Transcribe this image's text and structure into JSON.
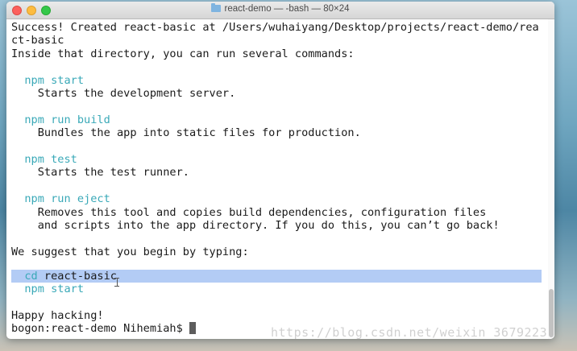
{
  "window": {
    "title": "react-demo — -bash — 80×24"
  },
  "terminal": {
    "lines": [
      "Success! Created react-basic at /Users/wuhaiyang/Desktop/projects/react-demo/rea",
      "ct-basic",
      "Inside that directory, you can run several commands:",
      "",
      "  npm start",
      "    Starts the development server.",
      "",
      "  npm run build",
      "    Bundles the app into static files for production.",
      "",
      "  npm test",
      "    Starts the test runner.",
      "",
      "  npm run eject",
      "    Removes this tool and copies build dependencies, configuration files",
      "    and scripts into the app directory. If you do this, you can’t go back!",
      "",
      "We suggest that you begin by typing:",
      "",
      "  cd react-basic",
      "  npm start",
      "",
      "Happy hacking!",
      "bogon:react-demo Nihemiah$ "
    ],
    "commands": {
      "npm_start": "npm start",
      "npm_run_build": "npm run build",
      "npm_test": "npm test",
      "npm_run_eject": "npm run eject",
      "cd": "cd",
      "cd_arg": " react-basic",
      "npm_start_2": "npm start"
    },
    "prompt": "bogon:react-demo Nihemiah$ "
  },
  "watermark": "https://blog.csdn.net/weixin_3679223",
  "colors": {
    "command": "#3aa9b8",
    "selection": "#b3ccf5",
    "text": "#1a1a1a"
  }
}
